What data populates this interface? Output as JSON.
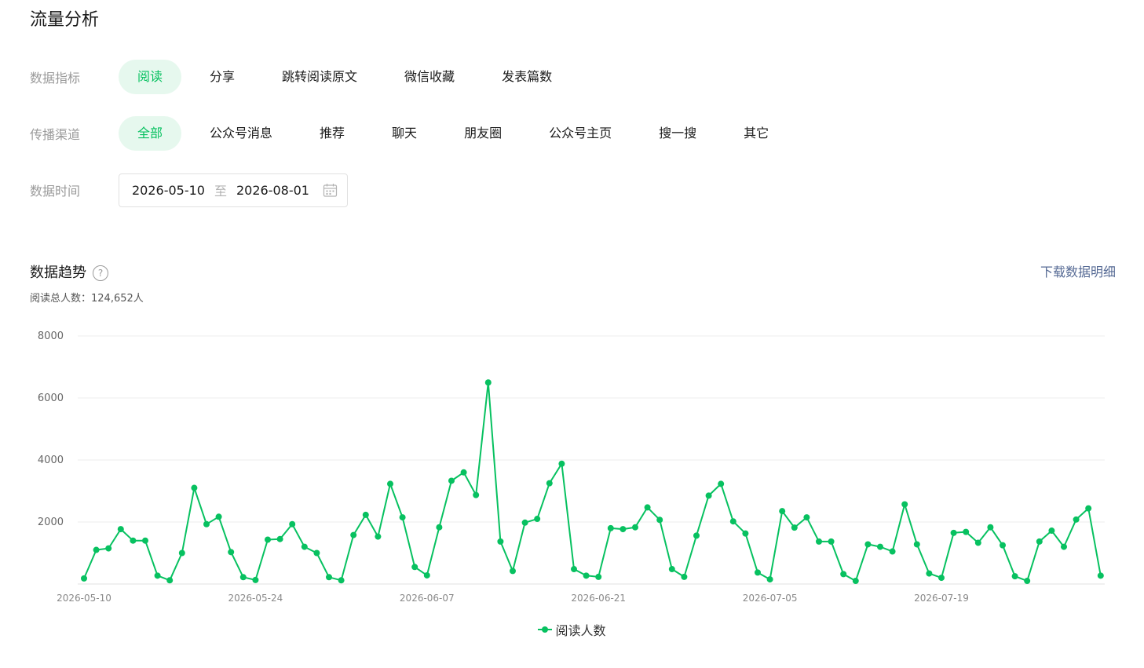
{
  "page": {
    "title": "流量分析"
  },
  "filters": {
    "metric": {
      "label": "数据指标",
      "options": [
        "阅读",
        "分享",
        "跳转阅读原文",
        "微信收藏",
        "发表篇数"
      ],
      "selected": "阅读"
    },
    "channel": {
      "label": "传播渠道",
      "options": [
        "全部",
        "公众号消息",
        "推荐",
        "聊天",
        "朋友圈",
        "公众号主页",
        "搜一搜",
        "其它"
      ],
      "selected": "全部"
    },
    "time": {
      "label": "数据时间",
      "start": "2026-05-10",
      "separator": "至",
      "end": "2026-08-01",
      "icon": "calendar-icon"
    }
  },
  "trend": {
    "title": "数据趋势",
    "help_icon": "?",
    "download_label": "下载数据明细",
    "total_label": "阅读总人数：",
    "total_value": "124,652人"
  },
  "colors": {
    "accent": "#07c160",
    "accent_bg": "#e6f8ee",
    "link": "#576b95"
  },
  "chart_data": {
    "type": "line",
    "title": "",
    "xlabel": "",
    "ylabel": "",
    "x_ticks": [
      "2026-05-10",
      "2026-05-24",
      "2026-06-07",
      "2026-06-21",
      "2026-07-05",
      "2026-07-19"
    ],
    "y_ticks": [
      2000,
      4000,
      6000,
      8000
    ],
    "ylim": [
      0,
      8000
    ],
    "grid": true,
    "legend_position": "bottom-center",
    "series": [
      {
        "name": "阅读人数",
        "color": "#07c160",
        "start_date": "2026-05-10",
        "values": [
          180,
          1100,
          1150,
          1770,
          1400,
          1400,
          270,
          120,
          1000,
          3100,
          1930,
          2170,
          1030,
          220,
          130,
          1430,
          1450,
          1930,
          1200,
          1000,
          220,
          120,
          1580,
          2230,
          1530,
          3230,
          2150,
          550,
          280,
          1830,
          3330,
          3600,
          2870,
          6500,
          1370,
          420,
          1980,
          2100,
          3250,
          3880,
          480,
          270,
          230,
          1800,
          1770,
          1830,
          2470,
          2070,
          480,
          230,
          1560,
          2850,
          3230,
          2020,
          1630,
          370,
          150,
          2350,
          1820,
          2150,
          1370,
          1370,
          320,
          100,
          1280,
          1200,
          1050,
          2570,
          1280,
          340,
          200,
          1650,
          1680,
          1330,
          1830,
          1250,
          250,
          100,
          1370,
          1720,
          1200,
          2080,
          2440,
          270
        ]
      }
    ]
  }
}
